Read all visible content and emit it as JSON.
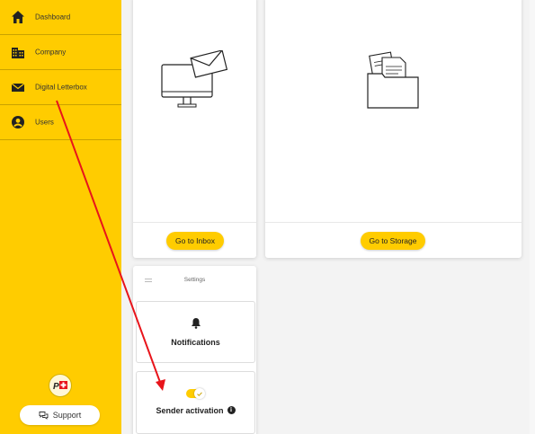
{
  "sidebar": {
    "items": [
      {
        "label": "Dashboard",
        "icon": "home-icon"
      },
      {
        "label": "Company",
        "icon": "buildings-icon"
      },
      {
        "label": "Digital Letterbox",
        "icon": "envelope-icon"
      },
      {
        "label": "Users",
        "icon": "user-circle-icon"
      }
    ],
    "logo": "swiss-post-logo",
    "support_label": "Support",
    "accent_color": "#FFCC00"
  },
  "cards": {
    "inbox": {
      "button_label": "Go to Inbox",
      "icon": "computer-mail-icon"
    },
    "storage": {
      "button_label": "Go to Storage",
      "icon": "folder-documents-icon"
    }
  },
  "settings": {
    "title": "Settings",
    "notifications_label": "Notifications",
    "sender_activation_label": "Sender activation",
    "sender_activation_enabled": true
  },
  "annotation": {
    "color": "#E8141B"
  }
}
